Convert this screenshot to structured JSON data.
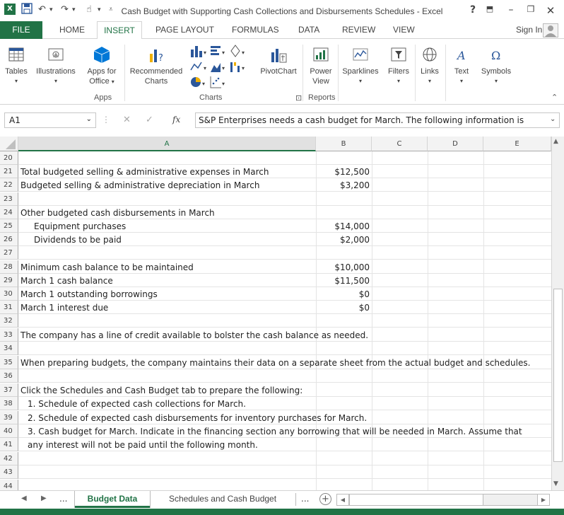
{
  "window": {
    "title": "Cash Budget with Supporting Cash Collections and Disbursements Schedules - Excel",
    "help": "?",
    "sign_in": "Sign In"
  },
  "ribbon_tabs": [
    "FILE",
    "HOME",
    "INSERT",
    "PAGE LAYOUT",
    "FORMULAS",
    "DATA",
    "REVIEW",
    "VIEW"
  ],
  "ribbon": {
    "tables": "Tables",
    "illustrations": "Illustrations",
    "apps_for_office_1": "Apps for",
    "apps_for_office_2": "Office",
    "recommended_charts_1": "Recommended",
    "recommended_charts_2": "Charts",
    "pivotchart": "PivotChart",
    "power_view_1": "Power",
    "power_view_2": "View",
    "sparklines": "Sparklines",
    "filters": "Filters",
    "links": "Links",
    "text": "Text",
    "symbols": "Symbols",
    "group_apps": "Apps",
    "group_charts": "Charts",
    "group_reports": "Reports"
  },
  "formula_bar": {
    "name_box": "A1",
    "fx": "fx",
    "content": "S&P Enterprises needs a cash budget for March. The following information is"
  },
  "columns": [
    "A",
    "B",
    "C",
    "D",
    "E"
  ],
  "rows": [
    {
      "n": "20",
      "a": "",
      "b": ""
    },
    {
      "n": "21",
      "a": "Total budgeted selling & administrative expenses in March",
      "b": "$12,500"
    },
    {
      "n": "22",
      "a": "Budgeted selling & administrative depreciation in March",
      "b": "$3,200"
    },
    {
      "n": "23",
      "a": "",
      "b": ""
    },
    {
      "n": "24",
      "a": "Other budgeted cash disbursements in March",
      "b": ""
    },
    {
      "n": "25",
      "a": "Equipment purchases",
      "b": "$14,000",
      "indent": true
    },
    {
      "n": "26",
      "a": "Dividends to be paid",
      "b": "$2,000",
      "indent": true
    },
    {
      "n": "27",
      "a": "",
      "b": ""
    },
    {
      "n": "28",
      "a": "Minimum cash balance to be maintained",
      "b": "$10,000"
    },
    {
      "n": "29",
      "a": "March 1 cash balance",
      "b": "$11,500"
    },
    {
      "n": "30",
      "a": "March 1 outstanding borrowings",
      "b": "$0"
    },
    {
      "n": "31",
      "a": "March 1 interest due",
      "b": "$0"
    },
    {
      "n": "32",
      "a": "",
      "b": ""
    },
    {
      "n": "33",
      "a": "The company has a line of credit available to bolster the cash balance as needed.",
      "b": ""
    },
    {
      "n": "34",
      "a": "",
      "b": ""
    },
    {
      "n": "35",
      "a": "When preparing budgets, the company maintains their data on a separate sheet from the actual budget and schedules.",
      "b": ""
    },
    {
      "n": "36",
      "a": "",
      "b": ""
    },
    {
      "n": "37",
      "a": "Click the Schedules and Cash Budget tab to prepare the following:",
      "b": ""
    },
    {
      "n": "38",
      "a": "1. Schedule of expected cash collections for March.",
      "b": "",
      "indent": true
    },
    {
      "n": "39",
      "a": "2. Schedule of expected cash disbursements for inventory purchases for March.",
      "b": "",
      "indent": true
    },
    {
      "n": "40",
      "a": "3. Cash budget for March. Indicate in the financing section any borrowing that will be needed in March.  Assume that",
      "b": "",
      "indent": true
    },
    {
      "n": "41",
      "a": "any interest will not be paid until the following month.",
      "b": "",
      "indent": true
    },
    {
      "n": "42",
      "a": "",
      "b": ""
    },
    {
      "n": "43",
      "a": "",
      "b": ""
    },
    {
      "n": "44",
      "a": "",
      "b": ""
    }
  ],
  "sheet_tabs": {
    "ellipsis": "...",
    "active": "Budget Data",
    "other": "Schedules and Cash Budget",
    "add": "+"
  },
  "colors": {
    "excel_green": "#217346",
    "accent": "#217346"
  }
}
